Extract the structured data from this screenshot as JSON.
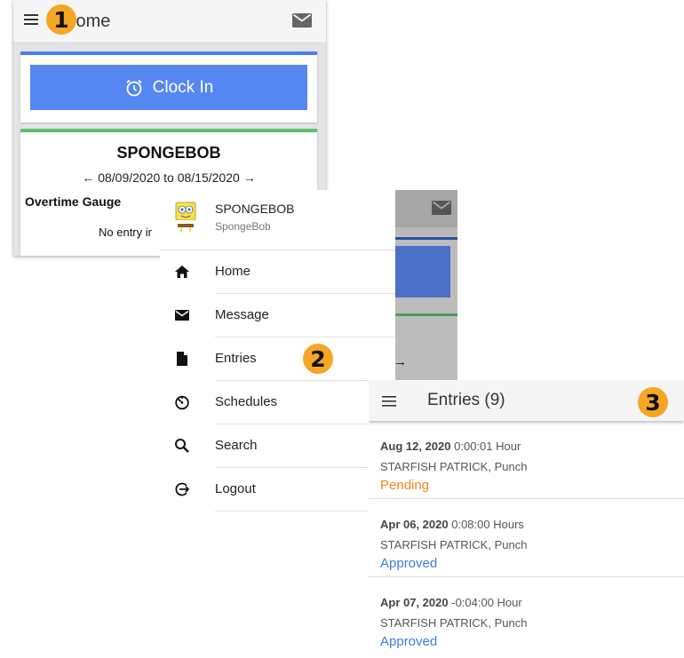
{
  "screen1": {
    "title": "Home",
    "icons": {
      "menu": "menu-icon",
      "mail": "mail-icon",
      "clock": "alarm-clock-icon"
    },
    "clock_in_label": "Clock In",
    "employee_name": "SPONGEBOB",
    "date_range": "08/09/2020 to 08/15/2020",
    "prev_arrow": "←",
    "next_arrow": "→",
    "overtime_label": "Overtime Gauge",
    "no_entry_text": "No entry ir",
    "colors": {
      "clock_button": "#5587f3",
      "card_top_blue": "#4a80ee",
      "card_top_green": "#5cc26c"
    }
  },
  "screen2": {
    "user": {
      "name": "SPONGEBOB",
      "username": "SpongeBob",
      "avatar": "spongebob-avatar"
    },
    "menu": [
      {
        "label": "Home",
        "icon": "home-icon"
      },
      {
        "label": "Message",
        "icon": "mail-icon"
      },
      {
        "label": "Entries",
        "icon": "file-icon"
      },
      {
        "label": "Schedules",
        "icon": "timer-icon"
      },
      {
        "label": "Search",
        "icon": "search-icon"
      },
      {
        "label": "Logout",
        "icon": "logout-icon"
      }
    ],
    "background_arrow": "→"
  },
  "screen3": {
    "title": "Entries (9)",
    "entries": [
      {
        "date": "Aug 12, 2020",
        "duration": "0:00:01 Hour",
        "name": "STARFISH PATRICK, Punch",
        "status": "Pending",
        "status_color": "#ef8a17"
      },
      {
        "date": "Apr 06, 2020",
        "duration": "0:08:00 Hours",
        "name": "STARFISH PATRICK, Punch",
        "status": "Approved",
        "status_color": "#3b7ddd"
      },
      {
        "date": "Apr 07, 2020",
        "duration": "-0:04:00 Hour",
        "name": "STARFISH PATRICK, Punch",
        "status": "Approved",
        "status_color": "#3b7ddd"
      }
    ]
  },
  "badges": [
    "1",
    "2",
    "3"
  ],
  "badge_color": "#f5a623"
}
